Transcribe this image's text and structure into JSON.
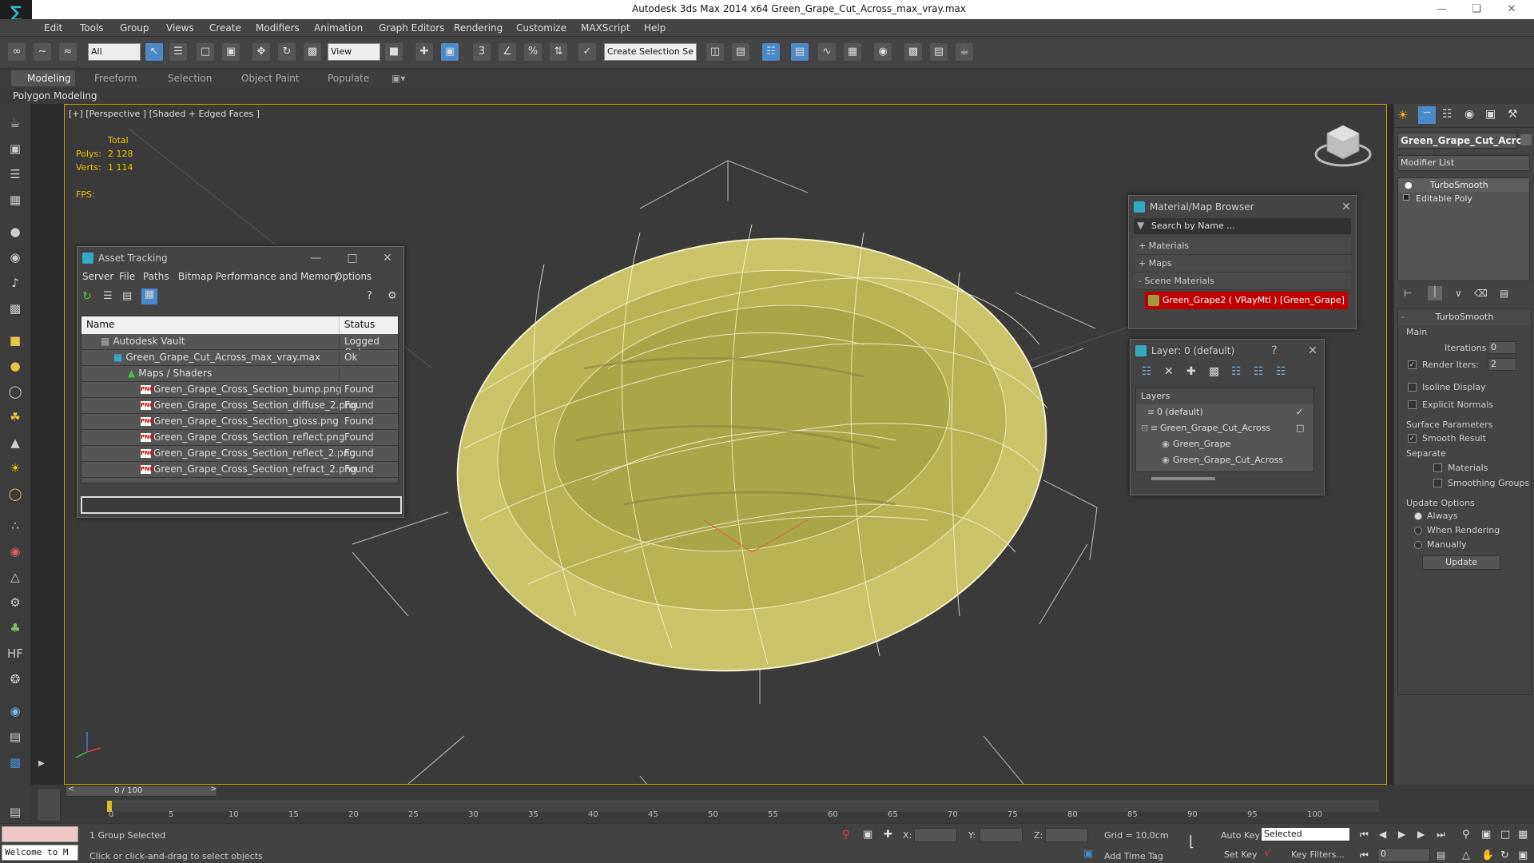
{
  "app": {
    "title": "Autodesk 3ds Max  2014 x64     Green_Grape_Cut_Across_max_vray.max"
  },
  "menu": [
    "Edit",
    "Tools",
    "Group",
    "Views",
    "Create",
    "Modifiers",
    "Animation",
    "Graph Editors",
    "Rendering",
    "Customize",
    "MAXScript",
    "Help"
  ],
  "toolbar": {
    "filter": "All",
    "refcoord": "View",
    "selection_set": "Create Selection Se"
  },
  "ribbon": {
    "tabs": [
      "Modeling",
      "Freeform",
      "Selection",
      "Object Paint",
      "Populate"
    ],
    "sub": "Polygon Modeling"
  },
  "viewport": {
    "label": "[+] [Perspective ] [Shaded + Edged Faces ]",
    "stats": {
      "total": "Total",
      "polys_label": "Polys:",
      "polys": "2 128",
      "verts_label": "Verts:",
      "verts": "1 114",
      "fps_label": "FPS:"
    }
  },
  "asset_tracking": {
    "title": "Asset Tracking",
    "menu": [
      "Server",
      "File",
      "Paths",
      "Bitmap Performance and Memory",
      "Options"
    ],
    "col_name": "Name",
    "col_status": "Status",
    "rows": [
      {
        "name": "Autodesk Vault",
        "status": "Logged Out"
      },
      {
        "name": "Green_Grape_Cut_Across_max_vray.max",
        "status": "Ok"
      },
      {
        "name": "Maps / Shaders",
        "status": ""
      },
      {
        "name": "Green_Grape_Cross_Section_bump.png",
        "status": "Found"
      },
      {
        "name": "Green_Grape_Cross_Section_diffuse_2.png",
        "status": "Found"
      },
      {
        "name": "Green_Grape_Cross_Section_gloss.png",
        "status": "Found"
      },
      {
        "name": "Green_Grape_Cross_Section_reflect.png",
        "status": "Found"
      },
      {
        "name": "Green_Grape_Cross_Section_reflect_2.png",
        "status": "Found"
      },
      {
        "name": "Green_Grape_Cross_Section_refract_2.png",
        "status": "Found"
      }
    ],
    "png_badge": "PNG"
  },
  "material_browser": {
    "title": "Material/Map Browser",
    "search": "Search by Name ...",
    "materials": "+ Materials",
    "maps": "+ Maps",
    "scene_materials": "- Scene Materials",
    "item": "Green_Grape2  ( VRayMtl )  [Green_Grape]"
  },
  "layer": {
    "title": "Layer: 0 (default)",
    "help": "?",
    "header": "Layers",
    "items": [
      "0 (default)",
      "Green_Grape_Cut_Across",
      "Green_Grape",
      "Green_Grape_Cut_Across"
    ]
  },
  "command_panel": {
    "object_name": "Green_Grape_Cut_Acros",
    "modifier_list": "Modifier List",
    "stack": [
      "TurboSmooth",
      "Editable Poly"
    ],
    "rollout": "TurboSmooth",
    "main": "Main",
    "iterations_label": "Iterations:",
    "iterations": "0",
    "render_iters_label": "Render Iters:",
    "render_iters": "2",
    "isoline": "Isoline Display",
    "explicit": "Explicit Normals",
    "surface": "Surface Parameters",
    "smooth": "Smooth Result",
    "separate": "Separate",
    "materials": "Materials",
    "smoothing": "Smoothing Groups",
    "update_options": "Update Options",
    "always": "Always",
    "when_rendering": "When Rendering",
    "manually": "Manually",
    "update": "Update"
  },
  "timeline": {
    "frame": "0 / 100",
    "ticks": [
      "0",
      "5",
      "10",
      "15",
      "20",
      "25",
      "30",
      "35",
      "40",
      "45",
      "50",
      "55",
      "60",
      "65",
      "70",
      "75",
      "80",
      "85",
      "90",
      "95",
      "100"
    ]
  },
  "status": {
    "maxscript": "Welcome to M",
    "selected": "1 Group Selected",
    "hint": "Click or click-and-drag to select objects",
    "x": "X:",
    "y": "Y:",
    "z": "Z:",
    "grid": "Grid = 10,0cm",
    "add_time_tag": "Add Time Tag",
    "auto_key": "Auto Key",
    "set_key": "Set Key",
    "selected_dd": "Selected",
    "key_filters": "Key Filters...",
    "frame": "0"
  },
  "colors": {
    "accent": "#c8a200",
    "grape": "#c9c46a",
    "selection_red": "#c00000"
  }
}
